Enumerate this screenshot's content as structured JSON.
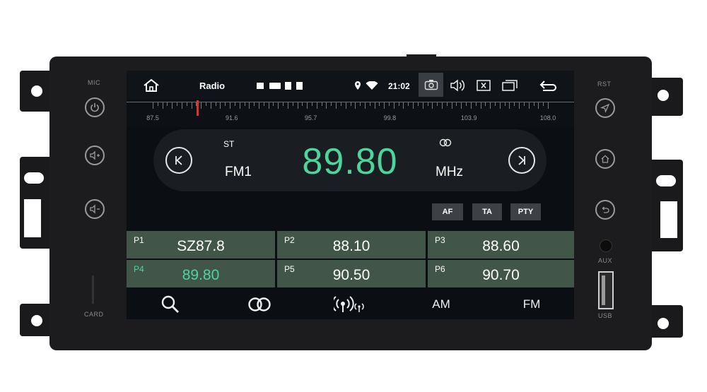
{
  "unit": {
    "left_labels": {
      "mic": "MIC",
      "card": "CARD"
    },
    "right_labels": {
      "rst": "RST",
      "aux": "AUX",
      "usb": "USB"
    },
    "left_buttons": [
      {
        "icon": "power-icon"
      },
      {
        "icon": "volume-up-icon"
      },
      {
        "icon": "volume-down-icon"
      }
    ],
    "right_buttons": [
      {
        "icon": "navigation-icon"
      },
      {
        "icon": "home-icon"
      },
      {
        "icon": "back-icon"
      }
    ]
  },
  "status_bar": {
    "home_icon": "home-icon",
    "title": "Radio",
    "notification_icons": [
      "image-icon",
      "rbc-icon",
      "sd-card-icon",
      "sim-card-icon"
    ],
    "right_icons": [
      "location-icon",
      "wifi-icon"
    ],
    "time": "21:02",
    "actions": [
      "screenshot-icon",
      "volume-icon",
      "close-box-icon",
      "recent-apps-icon",
      "back-icon"
    ]
  },
  "dial": {
    "labels": [
      "87.5",
      "91.6",
      "95.7",
      "99.8",
      "103.9",
      "108.0"
    ],
    "marker_color": "#e03030",
    "min": 87.5,
    "max": 108.0,
    "current": 89.8
  },
  "tuner": {
    "stereo": "ST",
    "band": "FM1",
    "frequency": "89.80",
    "unit": "MHz",
    "stereo_icon": "stereo-rings-icon",
    "prev_icon": "seek-prev-icon",
    "next_icon": "seek-next-icon",
    "freq_color": "#4cd69c"
  },
  "tags": [
    "AF",
    "TA",
    "PTY"
  ],
  "presets": [
    {
      "num": "P1",
      "freq": "SZ87.8",
      "active": false
    },
    {
      "num": "P2",
      "freq": "88.10",
      "active": false
    },
    {
      "num": "P3",
      "freq": "88.60",
      "active": false
    },
    {
      "num": "P4",
      "freq": "89.80",
      "active": true
    },
    {
      "num": "P5",
      "freq": "90.50",
      "active": false
    },
    {
      "num": "P6",
      "freq": "90.70",
      "active": false
    }
  ],
  "bottom_bar": {
    "search_icon": "search-icon",
    "stereo_icon": "stereo-icon",
    "scan_icon": "radio-scan-icon",
    "am": "AM",
    "fm": "FM"
  }
}
